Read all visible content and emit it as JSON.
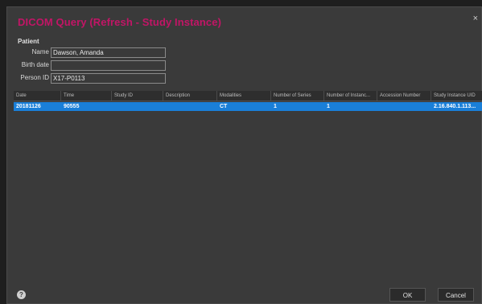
{
  "dialog": {
    "title": "DICOM Query (Refresh - Study Instance)",
    "close_glyph": "×"
  },
  "patient": {
    "section_label": "Patient",
    "name_label": "Name",
    "name_value": "Dawson, Amanda",
    "birth_label": "Birth date",
    "birth_value": "",
    "person_id_label": "Person ID",
    "person_id_value": "X17-P0113"
  },
  "table": {
    "columns": [
      "Date",
      "Time",
      "Study ID",
      "Description",
      "Modalities",
      "Number of Series",
      "Number of Instanc...",
      "Accession Number",
      "Study Instance UID"
    ],
    "rows": [
      [
        "20181126",
        "90555",
        "",
        "",
        "CT",
        "1",
        "1",
        "",
        "2.16.840.1.113..."
      ]
    ]
  },
  "footer": {
    "help_glyph": "?",
    "ok_label": "OK",
    "cancel_label": "Cancel"
  },
  "colors": {
    "title": "#c21566",
    "selection": "#1a7fd8",
    "background": "#3a3a3a"
  }
}
